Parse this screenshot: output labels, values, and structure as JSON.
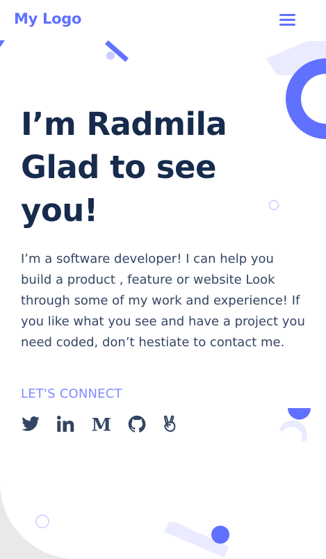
{
  "nav": {
    "logo": "My Logo",
    "menu_icon": "hamburger-menu-icon"
  },
  "hero": {
    "heading_lines": [
      "I’m Radmila",
      "Glad to see",
      "you!"
    ],
    "intro": "I’m a software developer! I can help you build a product , feature or website Look through some of my work and experience! If you like what you see and have a project you need coded, don’t hestiate to contact me.",
    "connect_label": "LET'S CONNECT"
  },
  "socials": [
    {
      "name": "twitter-icon"
    },
    {
      "name": "linkedin-icon"
    },
    {
      "name": "medium-icon"
    },
    {
      "name": "github-icon"
    },
    {
      "name": "angellist-icon"
    }
  ],
  "colors": {
    "accent": "#6070ff",
    "heading": "#172b4d",
    "body_text": "#344563",
    "connect": "#7f8cff",
    "decor_light": "#ebebff"
  }
}
